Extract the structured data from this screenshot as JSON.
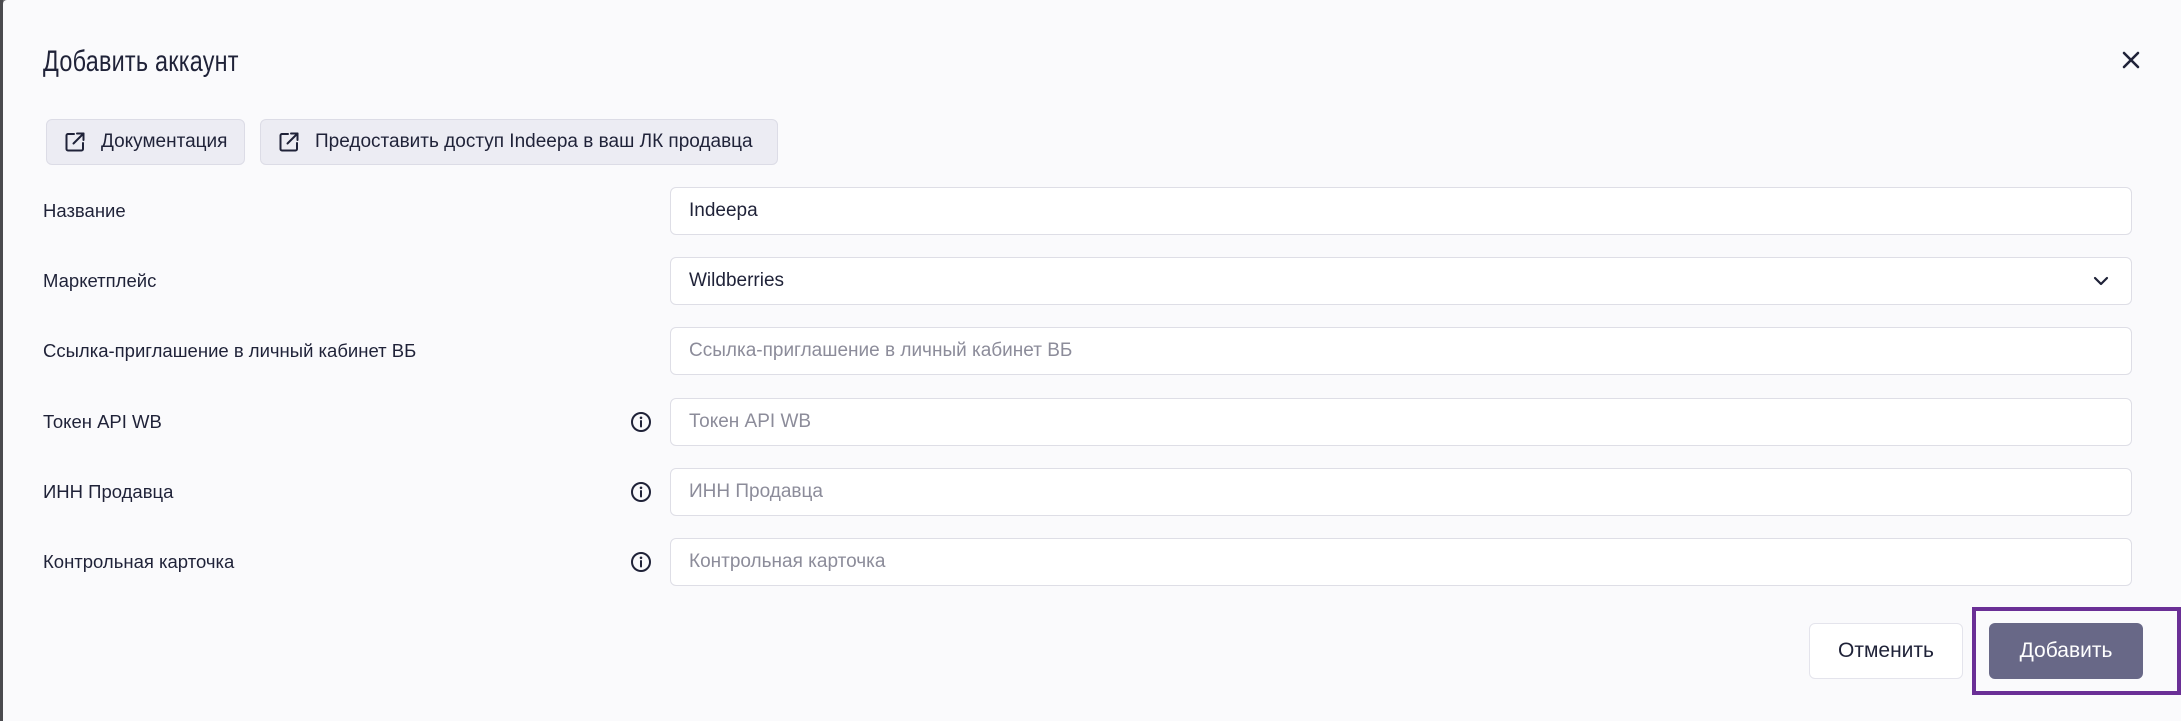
{
  "modal": {
    "title": "Добавить аккаунт"
  },
  "links": {
    "docs_label": "Документация",
    "access_label": "Предоставить доступ Indeepa в ваш ЛК продавца"
  },
  "form": {
    "name": {
      "label": "Название",
      "value": "Indeepa"
    },
    "marketplace": {
      "label": "Маркетплейс",
      "selected": "Wildberries"
    },
    "invite_link": {
      "label": "Ссылка-приглашение в личный кабинет ВБ",
      "placeholder": "Ссылка-приглашение в личный кабинет ВБ"
    },
    "api_token": {
      "label": "Токен API WB",
      "placeholder": "Токен API WB"
    },
    "seller_inn": {
      "label": "ИНН Продавца",
      "placeholder": "ИНН Продавца"
    },
    "control_card": {
      "label": "Контрольная карточка",
      "placeholder": "Контрольная карточка"
    }
  },
  "actions": {
    "cancel_label": "Отменить",
    "add_label": "Добавить"
  },
  "icons": {
    "close": "close-icon",
    "external_link": "external-link-icon",
    "info": "info-icon",
    "chevron": "chevron-down-icon"
  },
  "colors": {
    "primary_button": "#686887",
    "highlight_frame": "#6a2f96",
    "text": "#1f2238",
    "placeholder": "#8c8c9a"
  }
}
